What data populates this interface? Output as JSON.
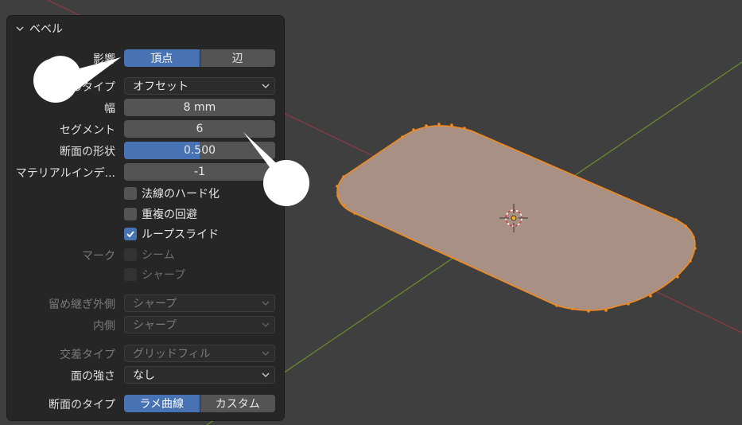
{
  "panel": {
    "title": "ベベル",
    "affect": {
      "label": "影響",
      "options": [
        "頂点",
        "辺"
      ],
      "active": 0
    },
    "width_type": {
      "label": "幅のタイプ",
      "value": "オフセット"
    },
    "width": {
      "label": "幅",
      "value": "8 mm"
    },
    "segments": {
      "label": "セグメント",
      "value": "6"
    },
    "shape": {
      "label": "断面の形状",
      "value": "0.500",
      "fill": 0.5
    },
    "material_index": {
      "label": "マテリアルインデ...",
      "value": "-1"
    },
    "harden_normals": {
      "label": "法線のハード化",
      "checked": false
    },
    "clamp_overlap": {
      "label": "重複の回避",
      "checked": false
    },
    "loop_slide": {
      "label": "ループスライド",
      "checked": true
    },
    "mark": {
      "label": "マーク",
      "seam": "シーム",
      "sharp": "シャープ"
    },
    "miter_outer": {
      "label": "留め継ぎ外側",
      "value": "シャープ"
    },
    "miter_inner": {
      "label": "内側",
      "value": "シャープ"
    },
    "intersection_type": {
      "label": "交差タイプ",
      "value": "グリッドフィル"
    },
    "face_strength": {
      "label": "面の強さ",
      "value": "なし"
    },
    "profile_type": {
      "label": "断面のタイプ",
      "options": [
        "ラメ曲線",
        "カスタム"
      ],
      "active": 0
    }
  },
  "viewport": {
    "background": "#3f3f3f",
    "x_axis_color": "#8a3a44",
    "y_axis_color": "#6a8a2e",
    "face_color": "#a89084",
    "edge_color": "#f28a1e"
  }
}
